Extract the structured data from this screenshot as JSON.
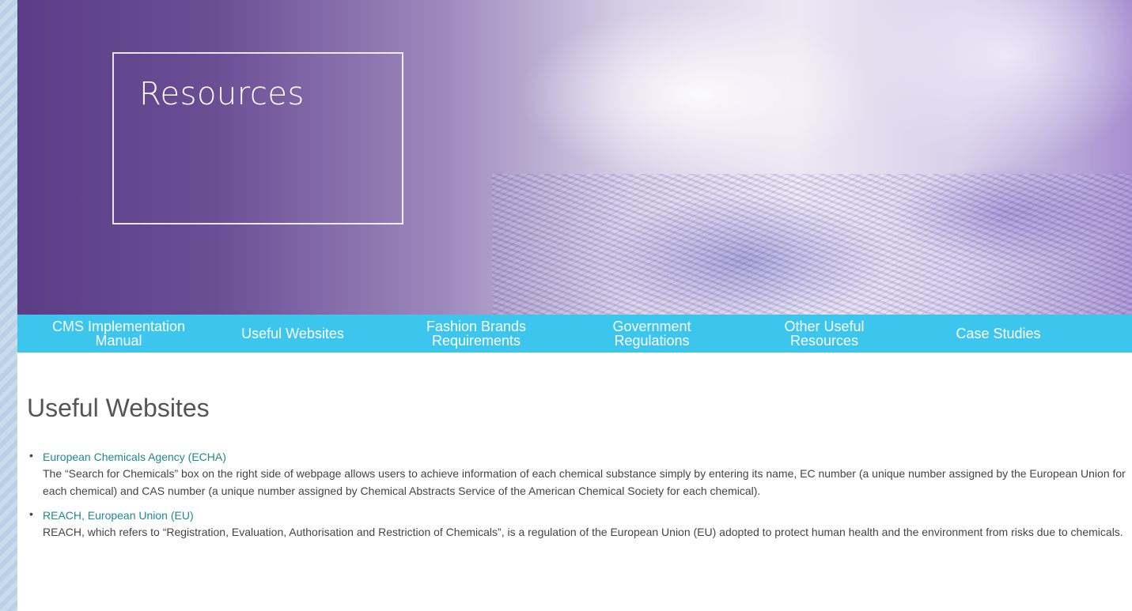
{
  "hero": {
    "title": "Resources"
  },
  "nav": {
    "items": [
      {
        "label": "CMS Implementation\nManual"
      },
      {
        "label": "Useful Websites"
      },
      {
        "label": "Fashion Brands\nRequirements"
      },
      {
        "label": "Government\nRegulations"
      },
      {
        "label": "Other Useful\nResources"
      },
      {
        "label": "Case Studies"
      }
    ]
  },
  "main": {
    "heading": "Useful Websites",
    "sites": [
      {
        "name": "European Chemicals Agency (ECHA)",
        "description": "The “Search for Chemicals” box on the right side of webpage allows users to achieve information of each chemical substance simply by entering its name, EC number (a unique number assigned by the European Union for each chemical) and CAS number (a unique number assigned by Chemical Abstracts Service of the American Chemical Society for each chemical)."
      },
      {
        "name": "REACH, European Union (EU)",
        "description": "REACH, which refers to “Registration, Evaluation, Authorisation and Restriction of Chemicals”, is a regulation of the European Union (EU) adopted to protect human health and the environment from risks due to chemicals."
      }
    ]
  },
  "colors": {
    "nav_background": "#3cc6ee",
    "link": "#1e8a8f",
    "heading": "#555555",
    "hero_dark": "#5a3d86"
  }
}
